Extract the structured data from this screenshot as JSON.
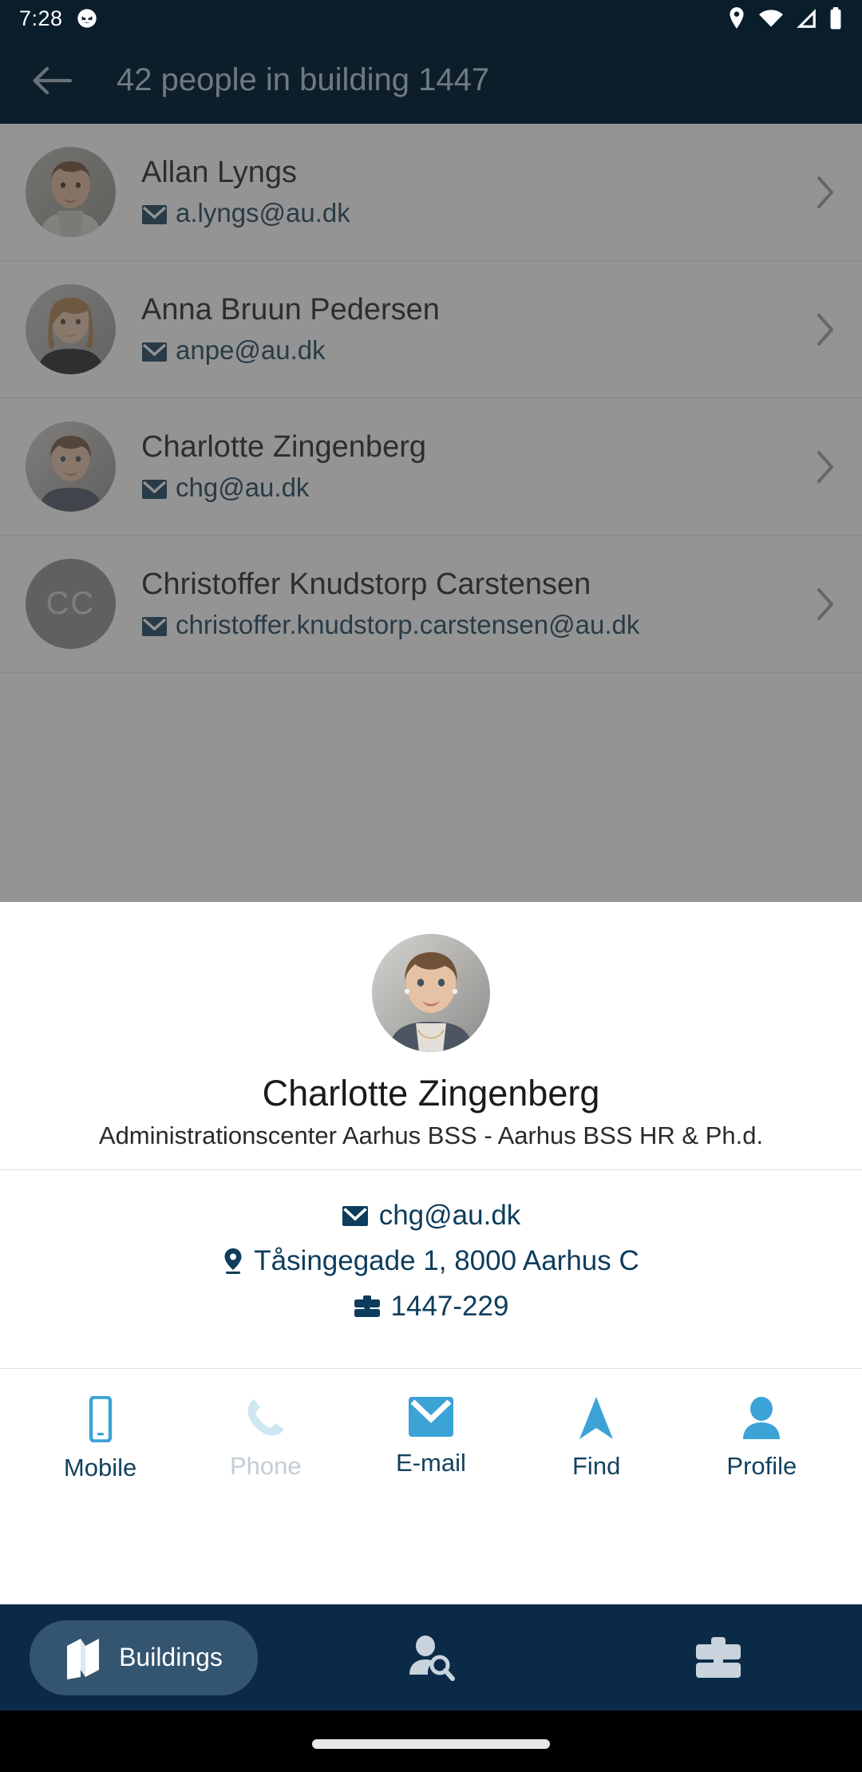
{
  "statusbar": {
    "time": "7:28",
    "icons": [
      "app-notification-icon",
      "location-icon",
      "wifi-icon",
      "cellular-signal-icon",
      "battery-icon"
    ]
  },
  "appbar": {
    "back_icon": "arrow-back-icon",
    "title": "42 people in building 1447"
  },
  "list": {
    "rows": [
      {
        "name": "Allan Lyngs",
        "email": "a.lyngs@au.dk",
        "avatar_type": "photo",
        "initials": ""
      },
      {
        "name": "Anna Bruun Pedersen",
        "email": "anpe@au.dk",
        "avatar_type": "photo",
        "initials": ""
      },
      {
        "name": "Charlotte Zingenberg",
        "email": "chg@au.dk",
        "avatar_type": "photo",
        "initials": ""
      },
      {
        "name": "Christoffer Knudstorp Carstensen",
        "email": "christoffer.knudstorp.carstensen@au.dk",
        "avatar_type": "initials",
        "initials": "CC"
      }
    ]
  },
  "detail": {
    "name": "Charlotte Zingenberg",
    "department": "Administrationscenter Aarhus BSS - Aarhus BSS HR & Ph.d.",
    "contact": [
      {
        "icon": "email-icon",
        "text": "chg@au.dk"
      },
      {
        "icon": "location-pin-icon",
        "text": "Tåsingegade 1, 8000 Aarhus C"
      },
      {
        "icon": "briefcase-icon",
        "text": "1447-229"
      }
    ],
    "actions": [
      {
        "label": "Mobile",
        "icon": "mobile-phone-icon",
        "enabled": true
      },
      {
        "label": "Phone",
        "icon": "telephone-handset-icon",
        "enabled": false
      },
      {
        "label": "E-mail",
        "icon": "email-icon",
        "enabled": true
      },
      {
        "label": "Find",
        "icon": "navigation-arrow-icon",
        "enabled": true
      },
      {
        "label": "Profile",
        "icon": "person-icon",
        "enabled": true
      }
    ]
  },
  "bottomnav": {
    "items": [
      {
        "label": "Buildings",
        "icon": "map-icon",
        "active": true
      },
      {
        "label": "",
        "icon": "person-search-icon",
        "active": false
      },
      {
        "label": "",
        "icon": "briefcase-icon",
        "active": false
      }
    ]
  },
  "colors": {
    "appbar": "#0b2336",
    "statusbar": "#0a1d2b",
    "accent": "#3ba3d6",
    "link": "#0d3c5c",
    "nav_bg": "#0b2a47",
    "nav_pill": "#345570",
    "disabled": "#c3ced5"
  }
}
